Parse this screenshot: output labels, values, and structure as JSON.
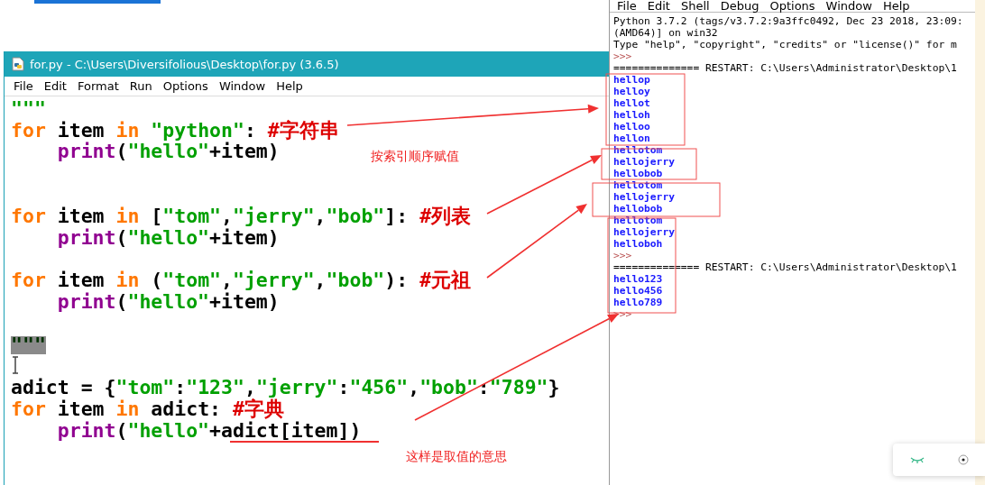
{
  "editor": {
    "title": "for.py - C:\\Users\\Diversifolious\\Desktop\\for.py (3.6.5)",
    "menu": [
      "File",
      "Edit",
      "Format",
      "Run",
      "Options",
      "Window",
      "Help"
    ],
    "lines": [
      {
        "selected": false,
        "tokens": [
          {
            "kind": "string",
            "text": "\"\"\""
          }
        ]
      },
      {
        "selected": false,
        "tokens": [
          {
            "kind": "keyword",
            "text": "for"
          },
          {
            "kind": "plain",
            "text": " item "
          },
          {
            "kind": "keyword",
            "text": "in "
          },
          {
            "kind": "string",
            "text": "\"python\""
          },
          {
            "kind": "plain",
            "text": ": "
          },
          {
            "kind": "comment",
            "text": "#字符串"
          }
        ]
      },
      {
        "selected": false,
        "tokens": [
          {
            "kind": "builtin",
            "text": "    print"
          },
          {
            "kind": "plain",
            "text": "("
          },
          {
            "kind": "string",
            "text": "\"hello\""
          },
          {
            "kind": "plain",
            "text": "+item)"
          }
        ]
      },
      {
        "selected": false
      },
      {
        "selected": false
      },
      {
        "selected": false,
        "tokens": [
          {
            "kind": "keyword",
            "text": "for"
          },
          {
            "kind": "plain",
            "text": " item "
          },
          {
            "kind": "keyword",
            "text": "in"
          },
          {
            "kind": "plain",
            "text": " ["
          },
          {
            "kind": "string",
            "text": "\"tom\""
          },
          {
            "kind": "plain",
            "text": ","
          },
          {
            "kind": "string",
            "text": "\"jerry\""
          },
          {
            "kind": "plain",
            "text": ","
          },
          {
            "kind": "string",
            "text": "\"bob\""
          },
          {
            "kind": "plain",
            "text": "]: "
          },
          {
            "kind": "comment",
            "text": "#列表"
          }
        ]
      },
      {
        "selected": false,
        "tokens": [
          {
            "kind": "builtin",
            "text": "    print"
          },
          {
            "kind": "plain",
            "text": "("
          },
          {
            "kind": "string",
            "text": "\"hello\""
          },
          {
            "kind": "plain",
            "text": "+item)"
          }
        ]
      },
      {
        "selected": false
      },
      {
        "selected": false,
        "tokens": [
          {
            "kind": "keyword",
            "text": "for"
          },
          {
            "kind": "plain",
            "text": " item "
          },
          {
            "kind": "keyword",
            "text": "in"
          },
          {
            "kind": "plain",
            "text": " ("
          },
          {
            "kind": "string",
            "text": "\"tom\""
          },
          {
            "kind": "plain",
            "text": ","
          },
          {
            "kind": "string",
            "text": "\"jerry\""
          },
          {
            "kind": "plain",
            "text": ","
          },
          {
            "kind": "string",
            "text": "\"bob\""
          },
          {
            "kind": "plain",
            "text": "): "
          },
          {
            "kind": "comment",
            "text": "#元祖"
          }
        ]
      },
      {
        "selected": false,
        "tokens": [
          {
            "kind": "builtin",
            "text": "    print"
          },
          {
            "kind": "plain",
            "text": "("
          },
          {
            "kind": "string",
            "text": "\"hello\""
          },
          {
            "kind": "plain",
            "text": "+item)"
          }
        ]
      },
      {
        "selected": false
      },
      {
        "selected": true,
        "tokens": [
          {
            "kind": "string",
            "text": "\"\"\""
          }
        ]
      },
      {
        "selected": false
      },
      {
        "selected": false,
        "tokens": [
          {
            "kind": "plain",
            "text": "adict = {"
          },
          {
            "kind": "string",
            "text": "\"tom\""
          },
          {
            "kind": "plain",
            "text": ":"
          },
          {
            "kind": "string",
            "text": "\"123\""
          },
          {
            "kind": "plain",
            "text": ","
          },
          {
            "kind": "string",
            "text": "\"jerry\""
          },
          {
            "kind": "plain",
            "text": ":"
          },
          {
            "kind": "string",
            "text": "\"456\""
          },
          {
            "kind": "plain",
            "text": ","
          },
          {
            "kind": "string",
            "text": "\"bob\""
          },
          {
            "kind": "plain",
            "text": ":"
          },
          {
            "kind": "string",
            "text": "\"789\""
          },
          {
            "kind": "plain",
            "text": "}"
          }
        ]
      },
      {
        "selected": false,
        "tokens": [
          {
            "kind": "keyword",
            "text": "for"
          },
          {
            "kind": "plain",
            "text": " item "
          },
          {
            "kind": "keyword",
            "text": "in"
          },
          {
            "kind": "plain",
            "text": " adict: "
          },
          {
            "kind": "comment",
            "text": "#字典"
          }
        ]
      },
      {
        "selected": false,
        "tokens": [
          {
            "kind": "builtin",
            "text": "    print"
          },
          {
            "kind": "plain",
            "text": "("
          },
          {
            "kind": "string",
            "text": "\"hello\""
          },
          {
            "kind": "plain",
            "text": "+adict[item])"
          }
        ]
      }
    ]
  },
  "shell": {
    "menu": [
      "File",
      "Edit",
      "Shell",
      "Debug",
      "Options",
      "Window",
      "Help"
    ],
    "lines": [
      {
        "kind": "info",
        "text": "Python 3.7.2 (tags/v3.7.2:9a3ffc0492, Dec 23 2018, 23:09:"
      },
      {
        "kind": "info",
        "text": "(AMD64)] on win32"
      },
      {
        "kind": "info",
        "text": "Type \"help\", \"copyright\", \"credits\" or \"license()\" for m"
      },
      {
        "kind": "prompt",
        "text": ">>>"
      },
      {
        "kind": "info",
        "text": "============== RESTART: C:\\Users\\Administrator\\Desktop\\1"
      },
      {
        "kind": "output",
        "text": "hellop"
      },
      {
        "kind": "output",
        "text": "helloy"
      },
      {
        "kind": "output",
        "text": "hellot"
      },
      {
        "kind": "output",
        "text": "helloh"
      },
      {
        "kind": "output",
        "text": "helloo"
      },
      {
        "kind": "output",
        "text": "hellon"
      },
      {
        "kind": "output",
        "text": "hellotom"
      },
      {
        "kind": "output",
        "text": "hellojerry"
      },
      {
        "kind": "output",
        "text": "hellobob"
      },
      {
        "kind": "output",
        "text": "hellotom"
      },
      {
        "kind": "output",
        "text": "hellojerry"
      },
      {
        "kind": "output",
        "text": "hellobob"
      },
      {
        "kind": "output",
        "text": "hellotom"
      },
      {
        "kind": "output",
        "text": "hellojerry"
      },
      {
        "kind": "output",
        "text": "helloboh"
      },
      {
        "kind": "prompt",
        "text": ">>>"
      },
      {
        "kind": "info",
        "text": "============== RESTART: C:\\Users\\Administrator\\Desktop\\1"
      },
      {
        "kind": "output",
        "text": "hello123"
      },
      {
        "kind": "output",
        "text": "hello456"
      },
      {
        "kind": "output",
        "text": "hello789"
      },
      {
        "kind": "prompt",
        "text": ">>>"
      }
    ]
  },
  "annotations": {
    "labels": [
      {
        "text": "按索引顺序赋值"
      },
      {
        "text": "这样是取值的意思"
      }
    ]
  }
}
